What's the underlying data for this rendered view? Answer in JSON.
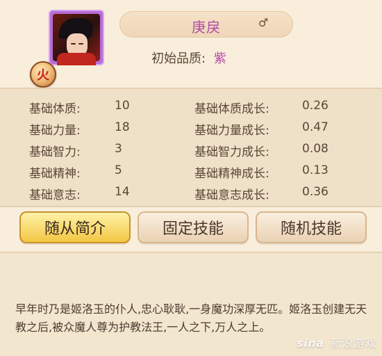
{
  "character": {
    "name": "庚戾",
    "gender_symbol": "♂",
    "element_badge": "火",
    "quality_label": "初始品质:",
    "quality_value": "紫"
  },
  "stats": [
    {
      "label": "基础体质:",
      "value": "10",
      "growth_label": "基础体质成长:",
      "growth_value": "0.26"
    },
    {
      "label": "基础力量:",
      "value": "18",
      "growth_label": "基础力量成长:",
      "growth_value": "0.47"
    },
    {
      "label": "基础智力:",
      "value": "3",
      "growth_label": "基础智力成长:",
      "growth_value": "0.08"
    },
    {
      "label": "基础精神:",
      "value": "5",
      "growth_label": "基础精神成长:",
      "growth_value": "0.13"
    },
    {
      "label": "基础意志:",
      "value": "14",
      "growth_label": "基础意志成长:",
      "growth_value": "0.36"
    }
  ],
  "tabs": [
    {
      "label": "随从简介",
      "active": true
    },
    {
      "label": "固定技能",
      "active": false
    },
    {
      "label": "随机技能",
      "active": false
    }
  ],
  "description": "早年时乃是姬洛玉的仆人,忠心耿耿,一身魔功深厚无匹。姬洛玉创建无天教之后,被众魔人尊为护教法王,一人之下,万人之上。",
  "watermark": {
    "brand": "sina",
    "text": "新浪游戏"
  }
}
